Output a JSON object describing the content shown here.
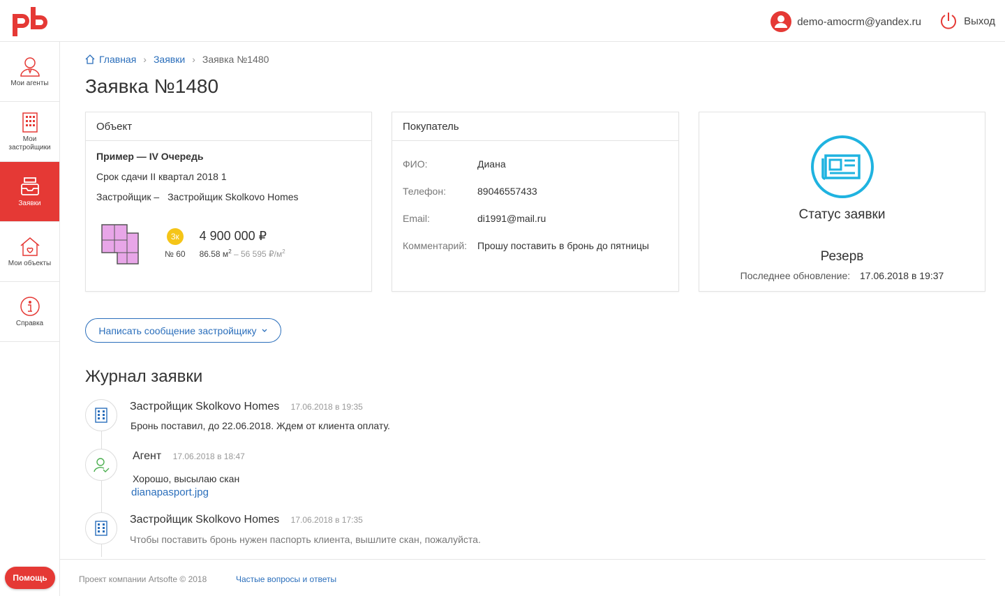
{
  "header": {
    "logo": "pb",
    "user_email": "demo-amocrm@yandex.ru",
    "logout_label": "Выход"
  },
  "sidebar": {
    "items": [
      {
        "label": "Мои агенты",
        "icon": "agent-icon"
      },
      {
        "label": "Мои застройщики",
        "icon": "building-icon"
      },
      {
        "label": "Заявки",
        "icon": "inbox-icon"
      },
      {
        "label": "Мои объекты",
        "icon": "house-icon"
      },
      {
        "label": "Справка",
        "icon": "info-icon"
      }
    ],
    "help_label": "Помощь"
  },
  "breadcrumb": {
    "home": "Главная",
    "requests": "Заявки",
    "current": "Заявка №1480"
  },
  "page_title": "Заявка №1480",
  "object_card": {
    "title": "Объект",
    "name": "Пример — IV Очередь",
    "deadline": "Срок сдачи II квартал 2018 1",
    "developer_label": "Застройщик –",
    "developer": "Застройщик Skolkovo Homes",
    "rooms_badge": "3к",
    "flat_number": "№ 60",
    "price": "4 900 000 ₽",
    "area": "86.58 м",
    "area_sup": "2",
    "price_per_m": " – 56 595 ₽/м",
    "price_per_sup": "2"
  },
  "buyer_card": {
    "title": "Покупатель",
    "rows": [
      {
        "label": "ФИО:",
        "value": "Диана"
      },
      {
        "label": "Телефон:",
        "value": "89046557433"
      },
      {
        "label": "Email:",
        "value": "di1991@mail.ru"
      },
      {
        "label": "Комментарий:",
        "value": "Прошу поставить в бронь до пятницы"
      }
    ]
  },
  "status_card": {
    "title": "Статус заявки",
    "value": "Резерв",
    "updated_label": "Последнее обновление:",
    "updated_value": "17.06.2018 в 19:37"
  },
  "message_button": "Написать сообщение застройщику",
  "journal": {
    "title": "Журнал заявки",
    "entries": [
      {
        "author": "Застройщик Skolkovo Homes",
        "date": "17.06.2018 в 19:35",
        "text": "Бронь поставил, до 22.06.2018. Ждем от клиента оплату."
      },
      {
        "author": "Агент",
        "date": "17.06.2018 в 18:47",
        "text": "Хорошо, высылаю скан",
        "attachment": "dianapasport.jpg"
      },
      {
        "author": "Застройщик Skolkovo Homes",
        "date": "17.06.2018 в 17:35",
        "text": "Чтобы поставить бронь нужен паспорть клиента, вышлите скан, пожалуйста."
      }
    ]
  },
  "footer": {
    "copyright": "Проект компании Artsofte © 2018",
    "faq": "Частые вопросы и ответы"
  },
  "colors": {
    "brand_red": "#e53935",
    "link_blue": "#2a6ebb",
    "status_cyan": "#1fb3e0",
    "badge_yellow": "#f5c518"
  }
}
